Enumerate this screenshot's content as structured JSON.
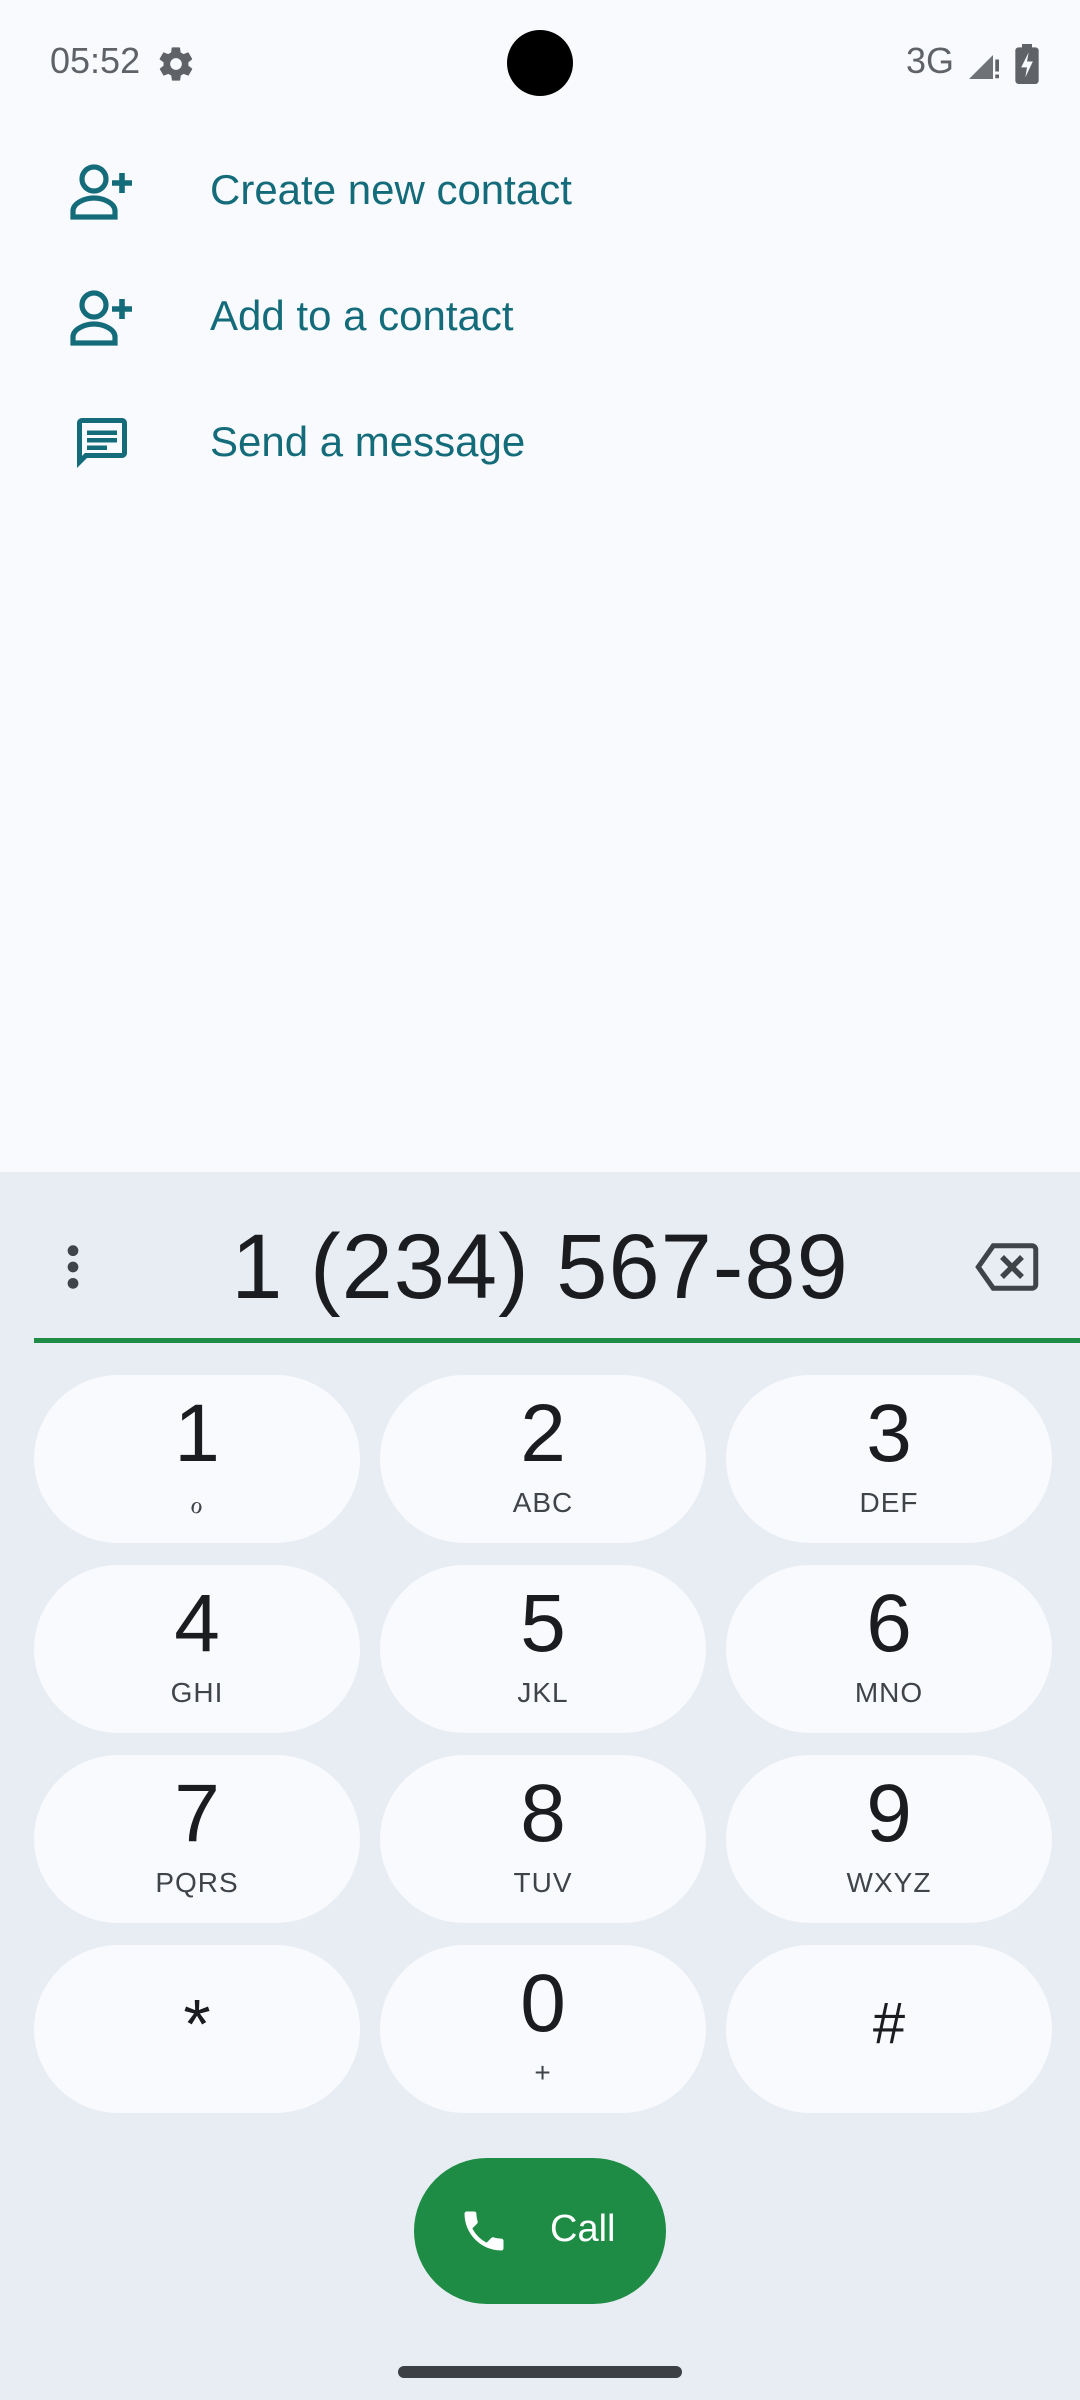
{
  "status_bar": {
    "time": "05:52",
    "network": "3G",
    "icons": [
      "gear-icon",
      "signal-icon",
      "battery-charging-icon"
    ]
  },
  "suggestions": [
    {
      "label": "Create new contact",
      "icon": "add-person-icon"
    },
    {
      "label": "Add to a contact",
      "icon": "add-person-icon"
    },
    {
      "label": "Send a message",
      "icon": "message-icon"
    }
  ],
  "dialpad": {
    "number": "1 (234) 567-89",
    "keys": [
      {
        "digit": "1",
        "letters": "ℴ"
      },
      {
        "digit": "2",
        "letters": "ABC"
      },
      {
        "digit": "3",
        "letters": "DEF"
      },
      {
        "digit": "4",
        "letters": "GHI"
      },
      {
        "digit": "5",
        "letters": "JKL"
      },
      {
        "digit": "6",
        "letters": "MNO"
      },
      {
        "digit": "7",
        "letters": "PQRS"
      },
      {
        "digit": "8",
        "letters": "TUV"
      },
      {
        "digit": "9",
        "letters": "WXYZ"
      },
      {
        "digit": "*",
        "letters": ""
      },
      {
        "digit": "0",
        "letters": "+"
      },
      {
        "digit": "#",
        "letters": ""
      }
    ]
  },
  "call_button": {
    "label": "Call"
  },
  "colors": {
    "accent_green": "#1E8C45",
    "link_teal": "#146C7A",
    "background": "#F9FAFE",
    "dial_background": "#E7EDF3"
  }
}
